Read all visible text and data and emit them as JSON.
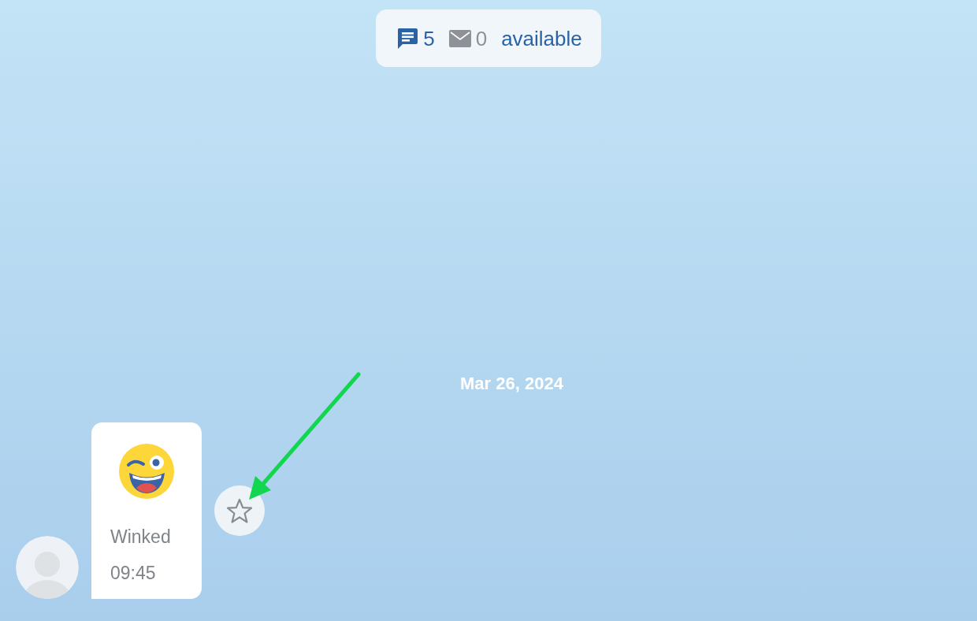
{
  "status_pill": {
    "message_count": "5",
    "email_count": "0",
    "status": "available"
  },
  "date_separator": "Mar 26, 2024",
  "messages": [
    {
      "reaction": "Winked",
      "time": "09:45",
      "starred": false
    }
  ]
}
